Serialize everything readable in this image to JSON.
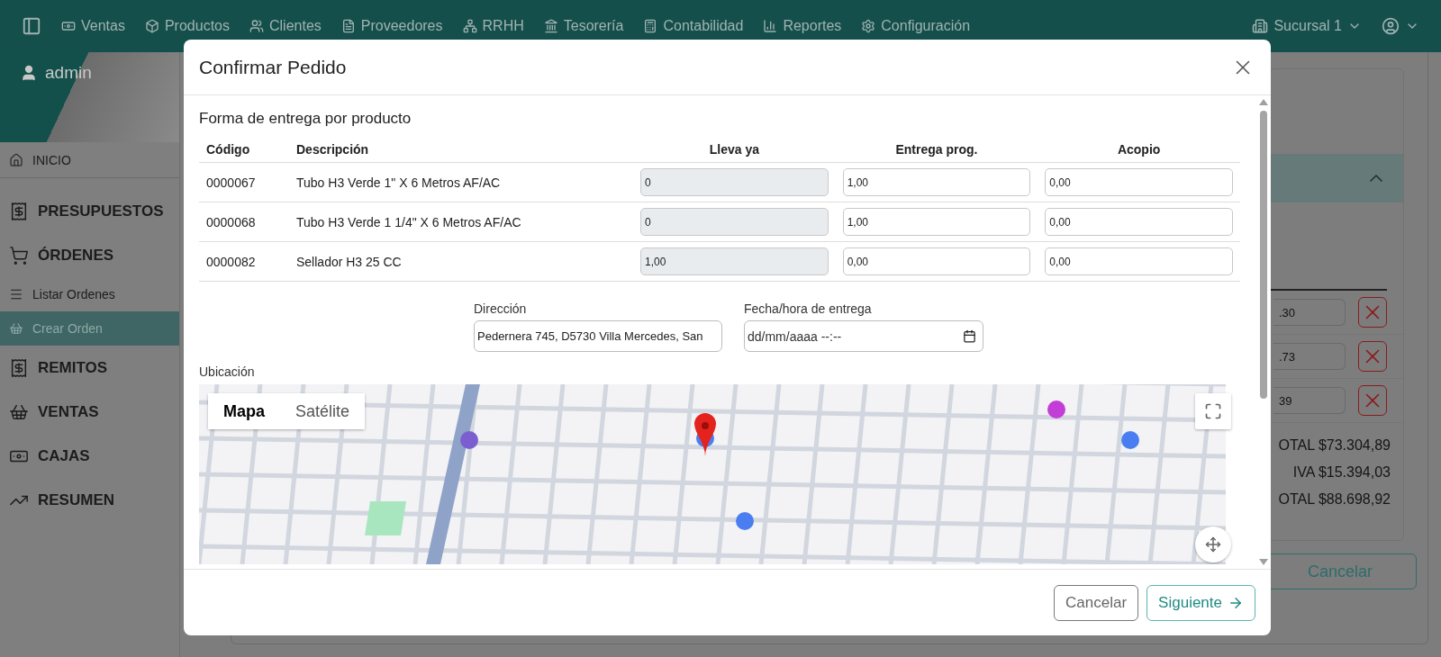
{
  "topbar": {
    "nav": [
      {
        "label": "Ventas"
      },
      {
        "label": "Productos"
      },
      {
        "label": "Clientes"
      },
      {
        "label": "Proveedores"
      },
      {
        "label": "RRHH"
      },
      {
        "label": "Tesorería"
      },
      {
        "label": "Contabilidad"
      },
      {
        "label": "Reportes"
      },
      {
        "label": "Configuración"
      }
    ],
    "branch": "Sucursal 1"
  },
  "sidebar": {
    "user": "admin",
    "items": [
      {
        "label": "INICIO",
        "kind": "home",
        "selected": false
      },
      {
        "label": "PRESUPUESTOS",
        "kind": "section",
        "selected": false
      },
      {
        "label": "ÓRDENES",
        "kind": "section",
        "selected": false
      },
      {
        "label": "Listar Ordenes",
        "kind": "sub",
        "selected": false
      },
      {
        "label": "Crear Orden",
        "kind": "sub",
        "selected": true
      },
      {
        "label": "REMITOS",
        "kind": "section",
        "selected": false
      },
      {
        "label": "VENTAS",
        "kind": "section",
        "selected": false
      },
      {
        "label": "CAJAS",
        "kind": "section",
        "selected": false
      },
      {
        "label": "RESUMEN",
        "kind": "section",
        "selected": false
      }
    ]
  },
  "background_panel": {
    "rows": [
      {
        "value": ".30"
      },
      {
        "value": ".73"
      },
      {
        "value": "39"
      }
    ],
    "totals": [
      "OTAL $73.304,89",
      "IVA $15.394,03",
      "OTAL $88.698,92"
    ],
    "cancel": "Cancelar"
  },
  "modal": {
    "title": "Confirmar Pedido",
    "section_title": "Forma de entrega por producto",
    "table": {
      "columns": [
        "Código",
        "Descripción",
        "Lleva ya",
        "Entrega prog.",
        "Acopio"
      ],
      "rows": [
        {
          "code": "0000067",
          "description": "Tubo H3 Verde 1\" X 6 Metros AF/AC",
          "inputs": [
            {
              "value": "0",
              "disabled": true
            },
            {
              "value": "1,00",
              "disabled": false
            },
            {
              "value": "0,00",
              "disabled": false
            }
          ]
        },
        {
          "code": "0000068",
          "description": "Tubo H3 Verde 1 1/4\" X 6 Metros AF/AC",
          "inputs": [
            {
              "value": "0",
              "disabled": true
            },
            {
              "value": "1,00",
              "disabled": false
            },
            {
              "value": "0,00",
              "disabled": false
            }
          ]
        },
        {
          "code": "0000082",
          "description": "Sellador H3 25 CC",
          "inputs": [
            {
              "value": "1,00",
              "disabled": true
            },
            {
              "value": "0,00",
              "disabled": false
            },
            {
              "value": "0,00",
              "disabled": false
            }
          ]
        }
      ]
    },
    "address": {
      "label": "Dirección",
      "value": "Pedernera 745, D5730 Villa Mercedes, San"
    },
    "delivery": {
      "label": "Fecha/hora de entrega",
      "placeholder": "dd/mm/aaaa --:--"
    },
    "location_label": "Ubicación",
    "map": {
      "tabs": [
        {
          "label": "Mapa",
          "selected": true
        },
        {
          "label": "Satélite",
          "selected": false
        }
      ]
    },
    "buttons": {
      "cancel": "Cancelar",
      "next": "Siguiente"
    }
  }
}
